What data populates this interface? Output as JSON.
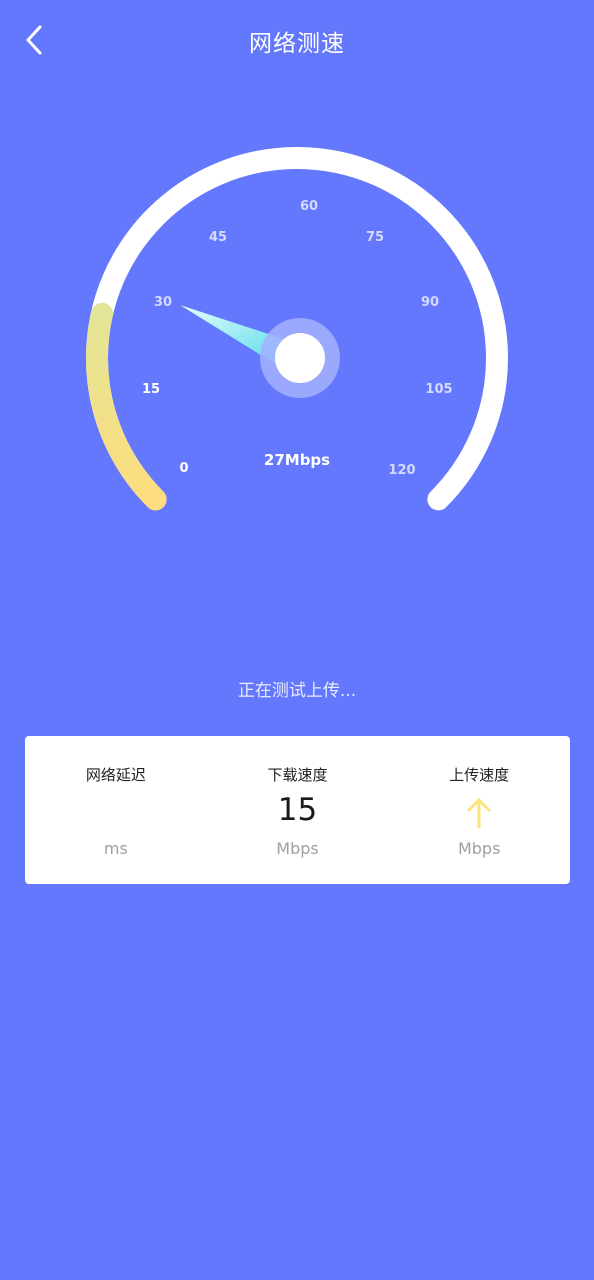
{
  "header": {
    "title": "网络测速",
    "back_icon": "chevron-left-icon"
  },
  "gauge": {
    "ticks": [
      "0",
      "15",
      "30",
      "45",
      "60",
      "75",
      "90",
      "105",
      "120"
    ],
    "current_speed_label": "27Mbps",
    "progress_value": 27,
    "max_value": 120,
    "colors": {
      "track": "#ffffff",
      "progress_start": "#e6e594",
      "progress_end": "#fcdd7e",
      "needle": "#7ef0e8",
      "hub_ring": "#a3b0fe",
      "hub": "#ffffff"
    }
  },
  "status_text": "正在测试上传...",
  "stats": {
    "latency": {
      "label": "网络延迟",
      "value": "",
      "unit": "ms"
    },
    "download": {
      "label": "下载速度",
      "value": "15",
      "unit": "Mbps"
    },
    "upload": {
      "label": "上传速度",
      "icon": "arrow-up-icon",
      "unit": "Mbps",
      "icon_color": "#fce27a"
    }
  },
  "colors": {
    "background": "#6478fe",
    "card": "#ffffff"
  }
}
